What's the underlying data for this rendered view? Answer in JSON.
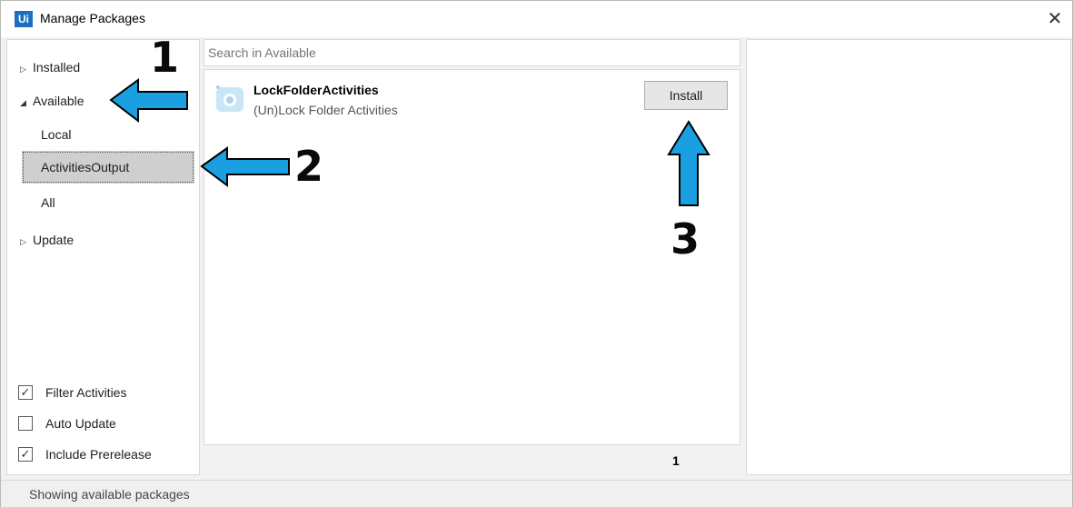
{
  "window": {
    "title": "Manage Packages",
    "app_icon": "Ui",
    "close": "✕"
  },
  "left": {
    "installed": "Installed",
    "available": "Available",
    "feeds": [
      {
        "label": "Local",
        "selected": false
      },
      {
        "label": "ActivitiesOutput",
        "selected": true
      },
      {
        "label": "All",
        "selected": false
      }
    ],
    "update": "Update",
    "options": [
      {
        "label": "Filter Activities",
        "checked": true
      },
      {
        "label": "Auto Update",
        "checked": false
      },
      {
        "label": "Include Prerelease",
        "checked": true
      }
    ]
  },
  "search": {
    "placeholder": "Search in Available",
    "value": ""
  },
  "packages": [
    {
      "name": "LockFolderActivities",
      "description": "(Un)Lock Folder Activities",
      "action": "Install"
    }
  ],
  "pager": {
    "page": "1"
  },
  "status": "Showing available packages",
  "annotations": {
    "one": "1",
    "two": "2",
    "three": "3"
  },
  "colors": {
    "arrow": "#1aa0e0",
    "accent": "#1b6ec2",
    "selected_bg": "#cfcfcf"
  }
}
